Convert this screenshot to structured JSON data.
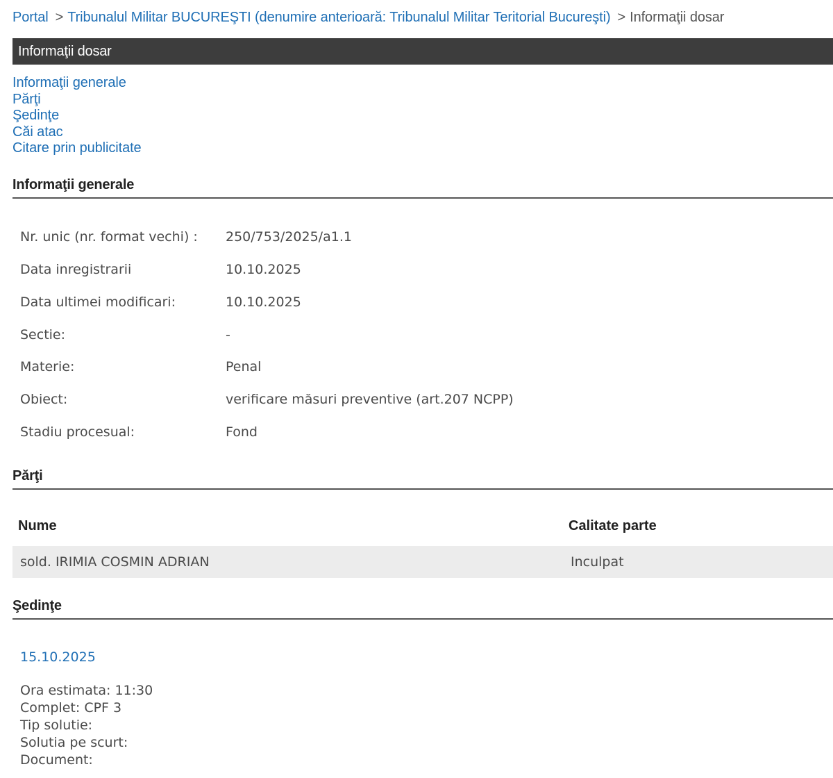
{
  "breadcrumb": {
    "portal": "Portal",
    "sep": ">",
    "court": "Tribunalul Militar BUCUREŞTI (denumire anterioară: Tribunalul Militar Teritorial Bucureşti)",
    "current": "Informaţii dosar"
  },
  "page_title": "Informaţii dosar",
  "quick_nav": [
    "Informaţii generale",
    "Părţi",
    "Şedinţe",
    "Căi atac",
    "Citare prin publicitate"
  ],
  "general": {
    "heading": "Informaţii generale",
    "rows": [
      {
        "label": "Nr. unic (nr. format vechi) :",
        "value": "250/753/2025/a1.1"
      },
      {
        "label": "Data inregistrarii",
        "value": "10.10.2025"
      },
      {
        "label": "Data ultimei modificari:",
        "value": "10.10.2025"
      },
      {
        "label": "Sectie:",
        "value": "-"
      },
      {
        "label": "Materie:",
        "value": "Penal"
      },
      {
        "label": "Obiect:",
        "value": "verificare măsuri preventive (art.207 NCPP)"
      },
      {
        "label": "Stadiu procesual:",
        "value": "Fond"
      }
    ]
  },
  "parties": {
    "heading": "Părţi",
    "columns": [
      "Nume",
      "Calitate parte"
    ],
    "rows": [
      {
        "name": "sold. IRIMIA COSMIN ADRIAN",
        "role": "Inculpat"
      }
    ]
  },
  "sessions": {
    "heading": "Şedinţe",
    "date": "15.10.2025",
    "details": [
      "Ora estimata: 11:30",
      "Complet: CPF 3",
      "Tip solutie:",
      "Solutia pe scurt:",
      "Document:"
    ]
  }
}
